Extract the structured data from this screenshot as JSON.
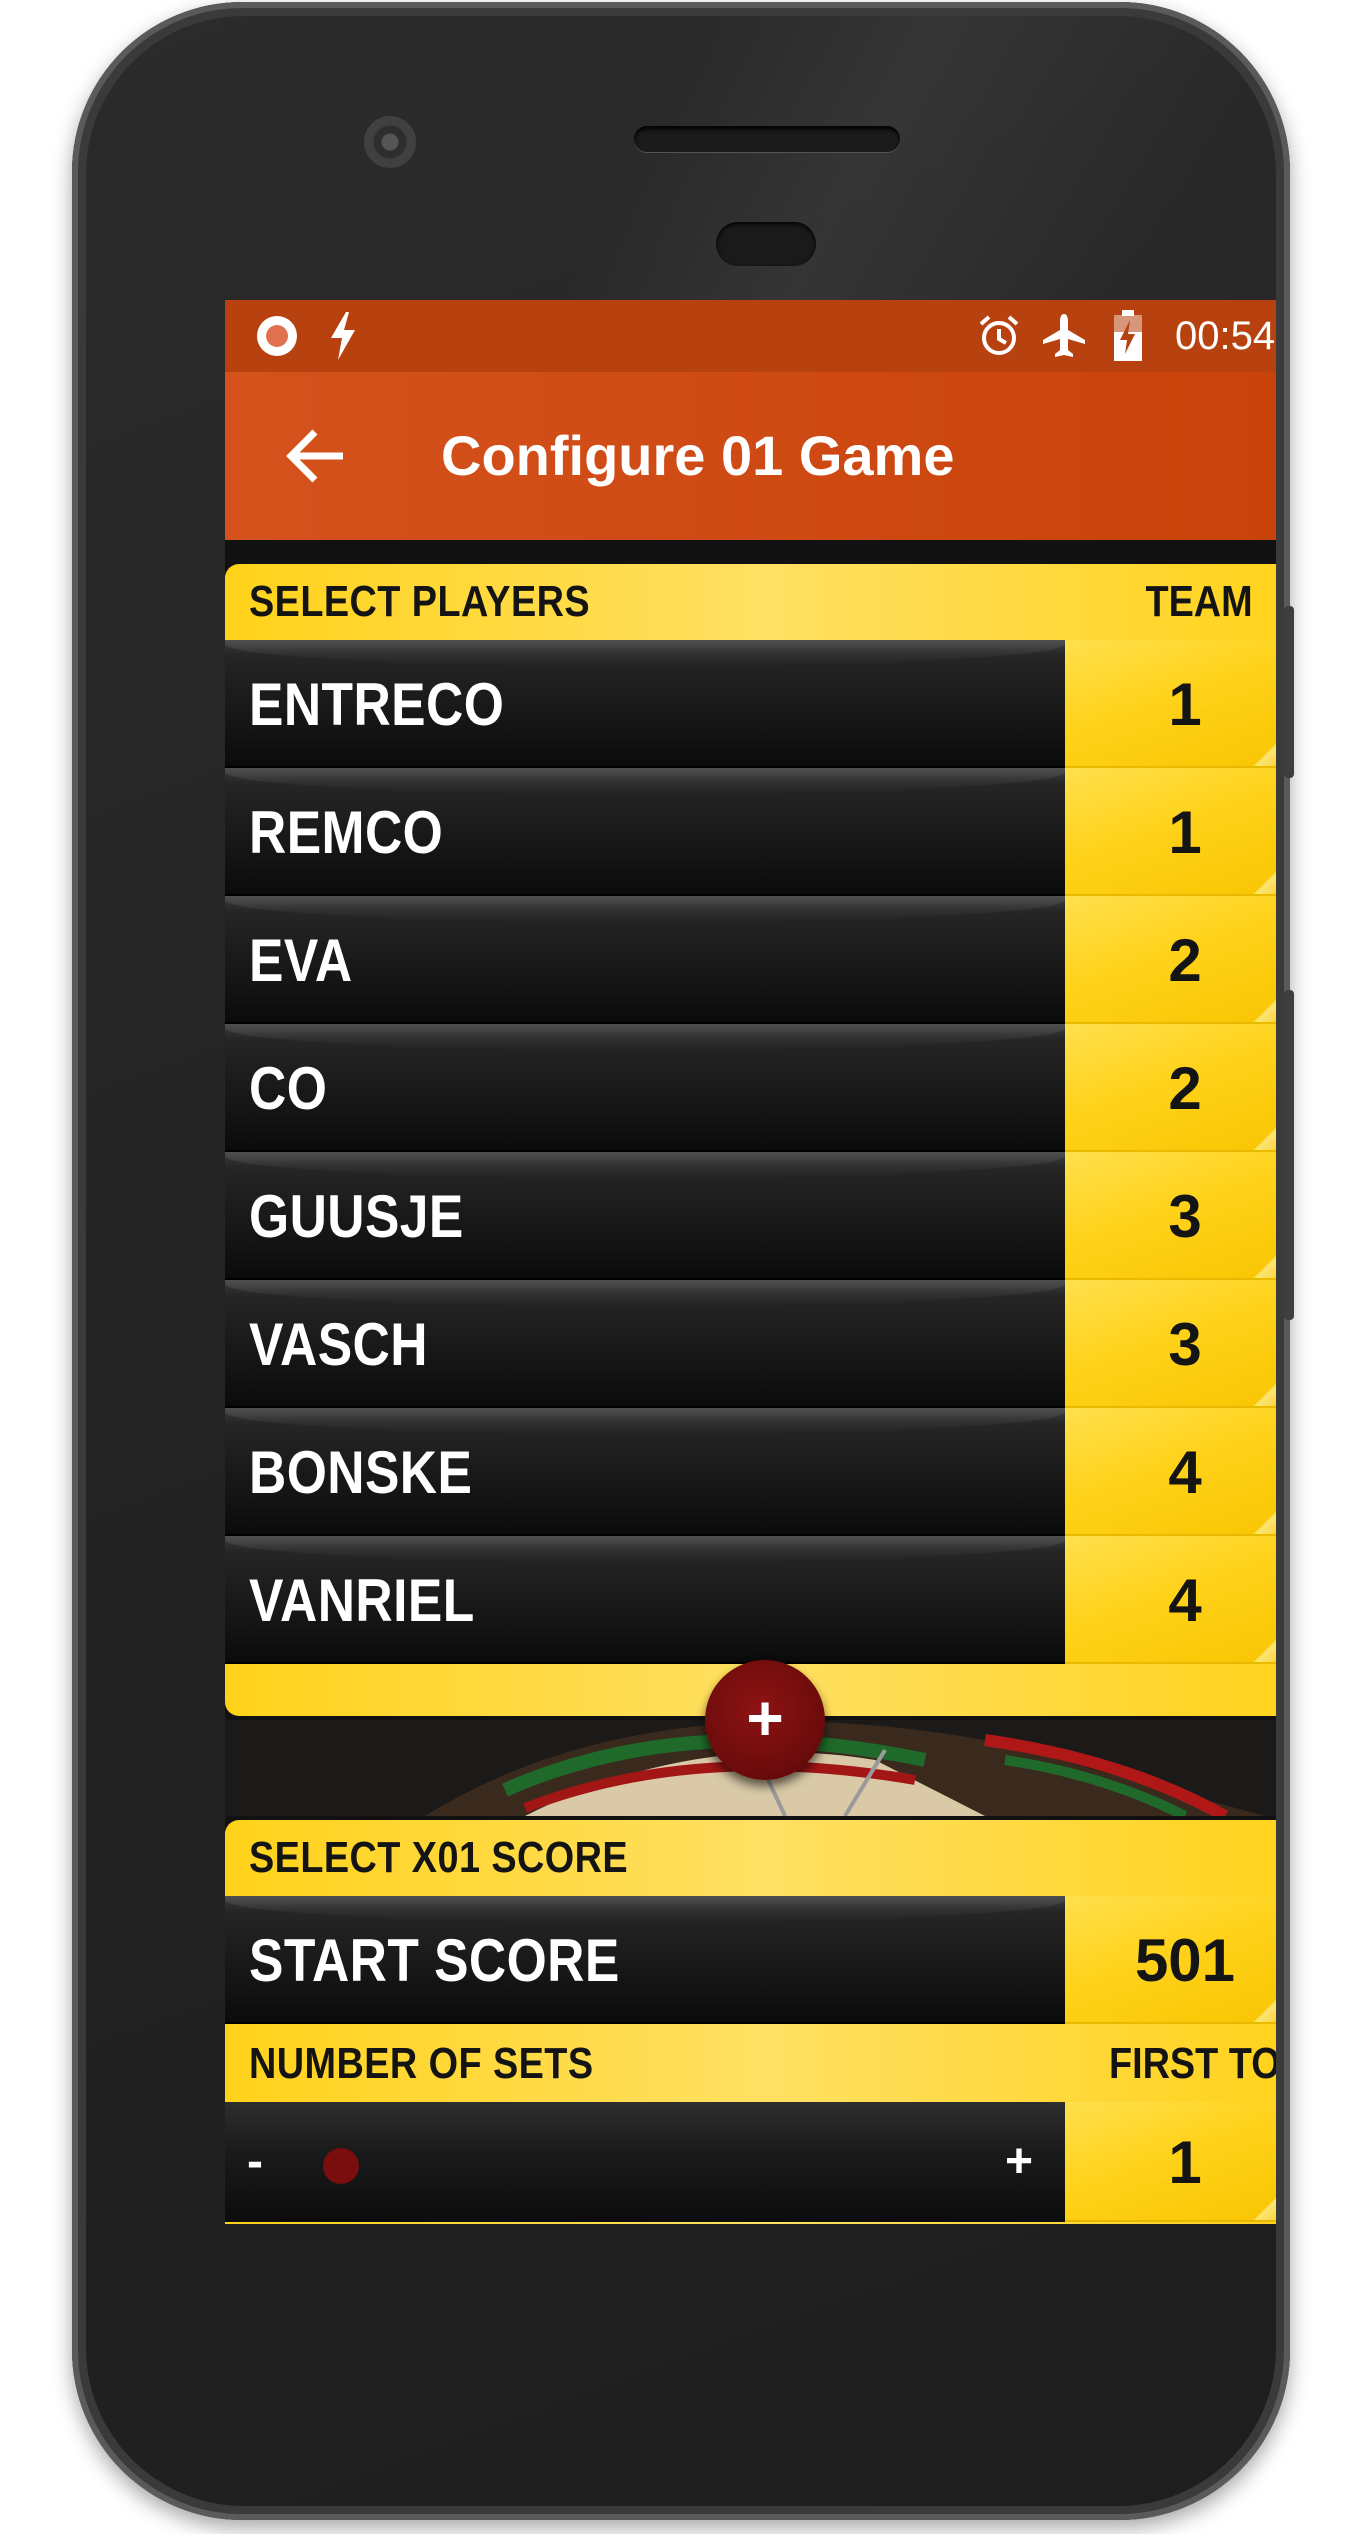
{
  "status_bar": {
    "time": "00:54"
  },
  "toolbar": {
    "title": "Configure 01 Game"
  },
  "players_section": {
    "header": "SELECT PLAYERS",
    "team_header": "TEAM",
    "players": [
      {
        "name": "ENTRECO",
        "team": "1"
      },
      {
        "name": "REMCO",
        "team": "1"
      },
      {
        "name": "EVA",
        "team": "2"
      },
      {
        "name": "CO",
        "team": "2"
      },
      {
        "name": "GUUSJE",
        "team": "3"
      },
      {
        "name": "VASCH",
        "team": "3"
      },
      {
        "name": "BONSKE",
        "team": "4"
      },
      {
        "name": "VANRIEL",
        "team": "4"
      }
    ],
    "add_label": "+"
  },
  "score_section": {
    "header": "SELECT X01 SCORE",
    "start_score_label": "START SCORE",
    "start_score_value": "501",
    "sets_label": "NUMBER OF SETS",
    "first_to_label": "FIRST TO",
    "sets_value": "1",
    "slider_minus": "-",
    "slider_plus": "+",
    "slider_level": 0.0
  },
  "colors": {
    "status_bar": "#b8420f",
    "toolbar": "#cf4a13",
    "accent_yellow": "#ffd21a",
    "add_button": "#7a0d0d"
  }
}
